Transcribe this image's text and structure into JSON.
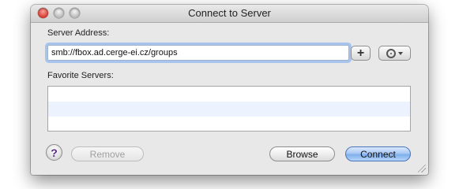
{
  "window": {
    "title": "Connect to Server"
  },
  "server_address": {
    "label": "Server Address:",
    "value": "smb://fbox.ad.cerge-ei.cz/groups"
  },
  "favorites": {
    "label": "Favorite Servers:",
    "items": []
  },
  "buttons": {
    "add": "+",
    "help": "?",
    "remove": "Remove",
    "browse": "Browse",
    "connect": "Connect"
  },
  "colors": {
    "accent": "#7eaeea",
    "focus_ring": "#a8c4ec",
    "close_button": "#d8392e",
    "list_alt_row": "#edf3fe"
  }
}
